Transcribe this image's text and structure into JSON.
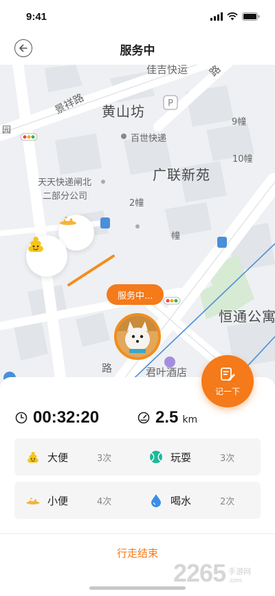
{
  "status_bar": {
    "time": "9:41"
  },
  "nav": {
    "title": "服务中"
  },
  "map": {
    "labels": {
      "huangshanfang": "黄山坊",
      "guanglian": "广联新苑",
      "hengtong": "恒通公寓",
      "junye": "君叶酒店",
      "baishi": "百世快递",
      "tiantian_1": "天天快递闸北",
      "tiantian_2": "二部分公司",
      "jingxiang": "景祥路",
      "zhongtong": "佳吉快运",
      "lu": "路",
      "lu2": "路",
      "yuan": "园",
      "b9": "9幢",
      "b10": "10幢",
      "b2": "2幢",
      "b_partial": "幢"
    },
    "status_pill": "服务中..."
  },
  "note_button": {
    "label": "记一下"
  },
  "stats": {
    "duration": "00:32:20",
    "distance": "2.5",
    "distance_unit": "km"
  },
  "activities": [
    {
      "label": "大便",
      "count": "3次",
      "icon": "poop-icon"
    },
    {
      "label": "玩耍",
      "count": "3次",
      "icon": "tennis-ball-icon"
    },
    {
      "label": "小便",
      "count": "4次",
      "icon": "pee-icon"
    },
    {
      "label": "喝水",
      "count": "2次",
      "icon": "water-drop-icon"
    }
  ],
  "footer": {
    "end_label": "行走结束"
  },
  "watermark": {
    "number": "2265",
    "cn": "手游网",
    "en": ".com"
  },
  "colors": {
    "accent": "#f47a1a",
    "poop": "#f5c518",
    "ball": "#1fb89a",
    "water": "#3a8ee8"
  }
}
